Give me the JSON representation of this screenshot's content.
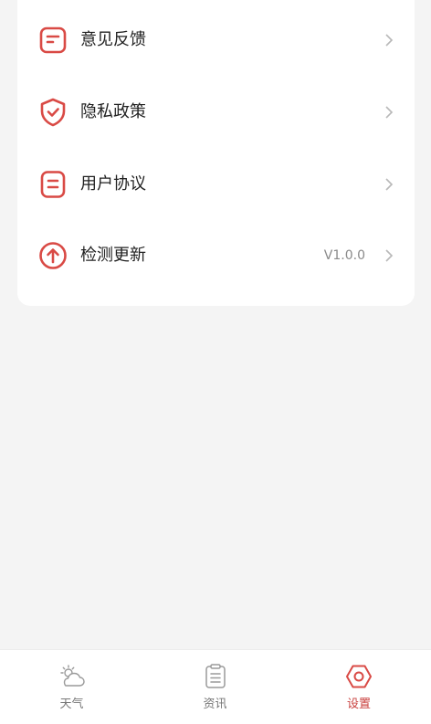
{
  "accent_color": "#d94a45",
  "settings": {
    "items": [
      {
        "label": "意见反馈",
        "icon": "feedback-icon",
        "value": ""
      },
      {
        "label": "隐私政策",
        "icon": "shield-check-icon",
        "value": ""
      },
      {
        "label": "用户协议",
        "icon": "document-icon",
        "value": ""
      },
      {
        "label": "检测更新",
        "icon": "arrow-up-circle-icon",
        "value": "V1.0.0"
      }
    ]
  },
  "tabbar": {
    "tabs": [
      {
        "label": "天气",
        "icon": "weather-icon",
        "active": false
      },
      {
        "label": "资讯",
        "icon": "news-clipboard-icon",
        "active": false
      },
      {
        "label": "设置",
        "icon": "settings-hexagon-icon",
        "active": true
      }
    ]
  }
}
